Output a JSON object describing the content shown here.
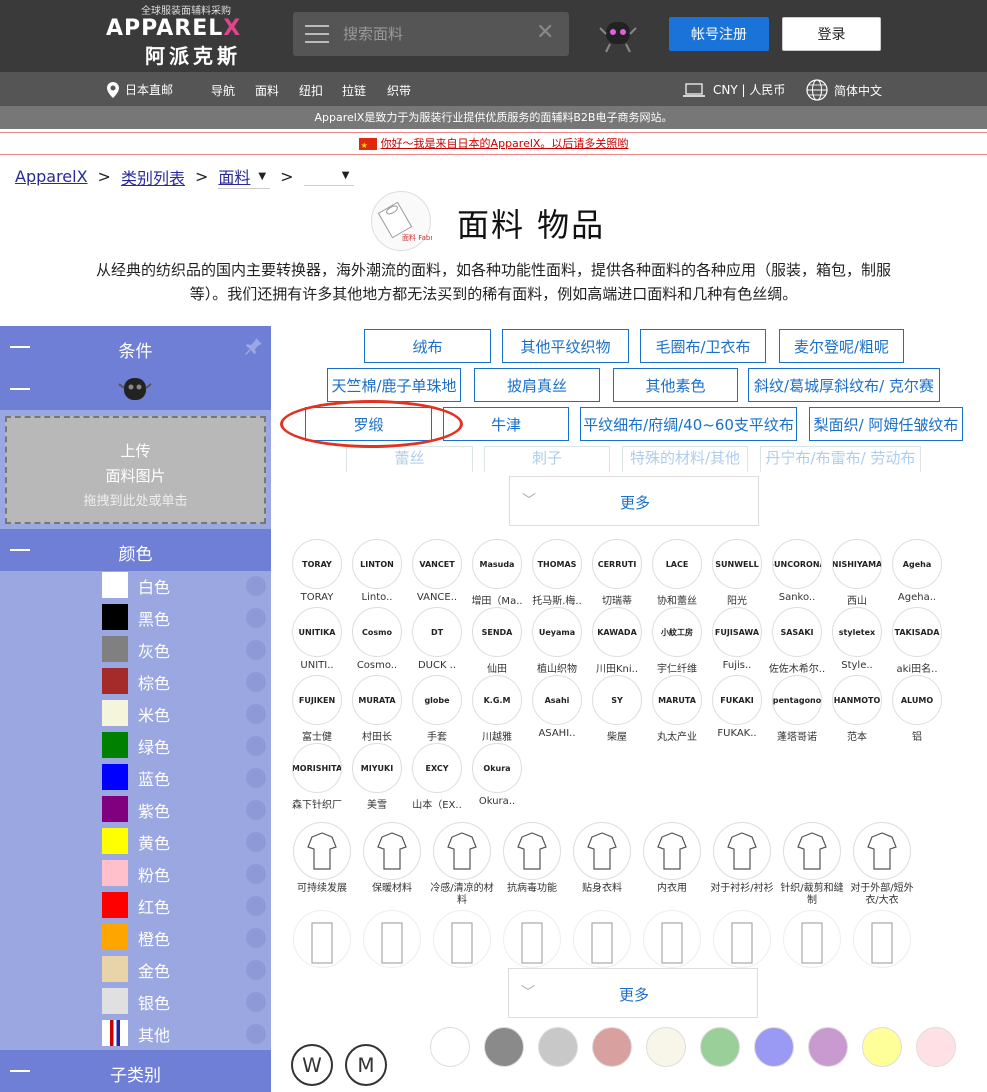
{
  "header": {
    "logo_sub": "全球服装面辅料采购",
    "logo_main": "APPAREL",
    "logo_x": "X",
    "logo_cn": "阿派克斯",
    "search_placeholder": "搜索面料",
    "register_label": "帐号注册",
    "login_label": "登录"
  },
  "nav": {
    "location": "日本直邮",
    "items": [
      "导航",
      "面料",
      "纽扣",
      "拉链",
      "织带"
    ],
    "currency": "CNY | 人民币",
    "language": "简体中文"
  },
  "tagline": "ApparelX是致力于为服装行业提供优质服务的面辅料B2B电子商务网站。",
  "notice": "你好～我是来自日本的ApparelX。以后请多关照哟",
  "breadcrumb": {
    "home": "ApparelX",
    "list": "类别列表",
    "current": "面料"
  },
  "category": {
    "logo_text": "面料 Fabric",
    "title": "面料 物品",
    "description": "从经典的纺织品的国内主要转换器，海外潮流的面料，如各种功能性面料，提供各种面料的各种应用（服装，箱包，制服等）。我们还拥有许多其他地方都无法买到的稀有面料，例如高端进口面料和几种有色丝绸。"
  },
  "sidebar": {
    "conditions": "条件",
    "upload": {
      "line1": "上传",
      "line2": "面料图片",
      "line3": "拖拽到此处或单击"
    },
    "color_header": "颜色",
    "colors": [
      {
        "name": "白色",
        "hex": "#ffffff"
      },
      {
        "name": "黑色",
        "hex": "#000000"
      },
      {
        "name": "灰色",
        "hex": "#808080"
      },
      {
        "name": "棕色",
        "hex": "#a52a2a"
      },
      {
        "name": "米色",
        "hex": "#f5f5dc"
      },
      {
        "name": "绿色",
        "hex": "#008000"
      },
      {
        "name": "蓝色",
        "hex": "#0000ff"
      },
      {
        "name": "紫色",
        "hex": "#800080"
      },
      {
        "name": "黄色",
        "hex": "#ffff00"
      },
      {
        "name": "粉色",
        "hex": "#ffc0cb"
      },
      {
        "name": "红色",
        "hex": "#ff0000"
      },
      {
        "name": "橙色",
        "hex": "#ffa500"
      },
      {
        "name": "金色",
        "hex": "#e8d4a8"
      },
      {
        "name": "银色",
        "hex": "#e0e0e0"
      },
      {
        "name": "其他",
        "hex": "#ffffff"
      }
    ],
    "subcategory_header": "子类别"
  },
  "tags": [
    "绒布",
    "其他平纹织物",
    "毛圈布/卫衣布",
    "麦尔登呢/粗呢",
    "天竺棉/鹿子单珠地",
    "披肩真丝",
    "其他素色",
    "斜纹/葛城厚斜纹布/ 克尔赛",
    "罗缎",
    "牛津",
    "平纹细布/府绸/40~60支平纹布",
    "梨面织/ 阿姆任皱纹布",
    "蕾丝",
    "刺子",
    "特殊的材料/其他",
    "丹宁布/布雷布/ 劳动布"
  ],
  "more_label": "更多",
  "brands": [
    {
      "name": "TORAY",
      "logo": "TORAY"
    },
    {
      "name": "Linto..",
      "logo": "LINTON"
    },
    {
      "name": "VANCE..",
      "logo": "VANCET"
    },
    {
      "name": "增田（Ma..",
      "logo": "Masuda"
    },
    {
      "name": "托马斯.梅..",
      "logo": "THOMAS"
    },
    {
      "name": "切瑞蒂",
      "logo": "CERRUTI"
    },
    {
      "name": "协和蕾丝",
      "logo": "LACE"
    },
    {
      "name": "阳光",
      "logo": "SUNWELL"
    },
    {
      "name": "Sanko..",
      "logo": "SUNCORONA"
    },
    {
      "name": "西山",
      "logo": "NISHIYAMA"
    },
    {
      "name": "Ageha..",
      "logo": "Ageha"
    },
    {
      "name": "UNITI..",
      "logo": "UNITIKA"
    },
    {
      "name": "Cosmo..",
      "logo": "Cosmo"
    },
    {
      "name": "DUCK ..",
      "logo": "DT"
    },
    {
      "name": "仙田",
      "logo": "SENDA"
    },
    {
      "name": "植山织物",
      "logo": "Ueyama"
    },
    {
      "name": "川田Kni..",
      "logo": "KAWADA"
    },
    {
      "name": "宇仁纤维",
      "logo": "小紋工房"
    },
    {
      "name": "Fujis..",
      "logo": "FUJISAWA"
    },
    {
      "name": "佐佐木希尔..",
      "logo": "SASAKI"
    },
    {
      "name": "Style..",
      "logo": "styletex"
    },
    {
      "name": "aki田名..",
      "logo": "TAKISADA"
    },
    {
      "name": "富士健",
      "logo": "FUJIKEN"
    },
    {
      "name": "村田长",
      "logo": "MURATA"
    },
    {
      "name": "手套",
      "logo": "globe"
    },
    {
      "name": "川越雅",
      "logo": "K.G.M"
    },
    {
      "name": "ASAHI..",
      "logo": "Asahi"
    },
    {
      "name": "柴屋",
      "logo": "SY"
    },
    {
      "name": "丸太产业",
      "logo": "MARUTA"
    },
    {
      "name": "FUKAK..",
      "logo": "FUKAKI"
    },
    {
      "name": "蓬塔哥诺",
      "logo": "pentagono"
    },
    {
      "name": "范本",
      "logo": "HANMOTO"
    },
    {
      "name": "铝",
      "logo": "ALUMO"
    },
    {
      "name": "森下针织厂",
      "logo": "MORISHITA"
    },
    {
      "name": "美雪",
      "logo": "MIYUKI"
    },
    {
      "name": "山本（EX..",
      "logo": "EXCY"
    },
    {
      "name": "Okura..",
      "logo": "Okura"
    }
  ],
  "usages": [
    "可持续发展",
    "保暖材料",
    "冷感/清凉的材料",
    "抗病毒功能",
    "贴身衣料",
    "内衣用",
    "对于衬衫/衬衫",
    "针织/裁剪和缝制",
    "对于外部/短外衣/大衣"
  ],
  "swatch_colors": [
    "#ffffff",
    "#8a8a8a",
    "#c8c8c8",
    "#d9a0a0",
    "#f7f6e8",
    "#9acf9a",
    "#9a9af5",
    "#c99ad0",
    "#ffff9a",
    "#ffe0e4"
  ]
}
